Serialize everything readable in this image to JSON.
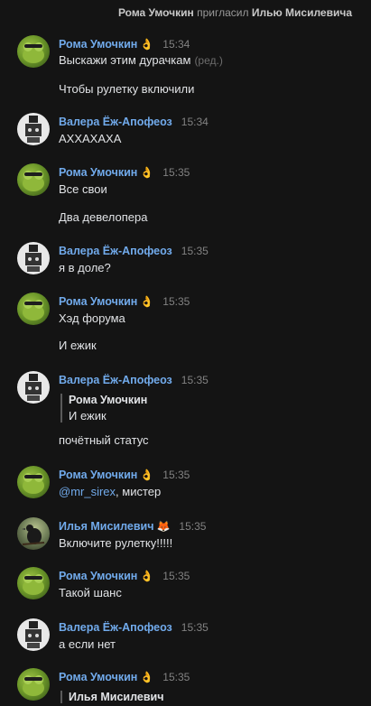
{
  "system": {
    "actor": "Рома Умочкин",
    "action": "пригласил",
    "target": "Илью Мисилевича"
  },
  "messages": [
    {
      "author": "Рома Умочкин",
      "badge": "👌",
      "time": "15:34",
      "lines": [
        "Выскажи этим дурачкам",
        "Чтобы рулетку включили"
      ],
      "edited_label": "(ред.)"
    },
    {
      "author": "Валера Ёж-Апофеоз",
      "time": "15:34",
      "lines": [
        "АХХАХАХА"
      ]
    },
    {
      "author": "Рома Умочкин",
      "badge": "👌",
      "time": "15:35",
      "lines": [
        "Все свои",
        "Два девелопера"
      ]
    },
    {
      "author": "Валера Ёж-Апофеоз",
      "time": "15:35",
      "lines": [
        "я в доле?"
      ]
    },
    {
      "author": "Рома Умочкин",
      "badge": "👌",
      "time": "15:35",
      "lines": [
        "Хэд форума",
        "И ежик"
      ]
    },
    {
      "author": "Валера Ёж-Апофеоз",
      "time": "15:35",
      "quote": {
        "author": "Рома Умочкин",
        "text": "И ежик"
      },
      "lines": [
        "почётный статус"
      ]
    },
    {
      "author": "Рома Умочкин",
      "badge": "👌",
      "time": "15:35",
      "mention": "@mr_sirex",
      "lines": [
        ", мистер"
      ]
    },
    {
      "author": "Илья Мисилевич",
      "badge": "🦊",
      "time": "15:35",
      "lines": [
        "Включите рулетку!!!!!"
      ]
    },
    {
      "author": "Рома Умочкин",
      "badge": "👌",
      "time": "15:35",
      "lines": [
        "Такой шанс"
      ]
    },
    {
      "author": "Валера Ёж-Апофеоз",
      "time": "15:35",
      "lines": [
        "а если нет"
      ]
    },
    {
      "author": "Рома Умочкин",
      "badge": "👌",
      "time": "15:35",
      "quote": {
        "author": "Илья Мисилевич"
      }
    }
  ]
}
